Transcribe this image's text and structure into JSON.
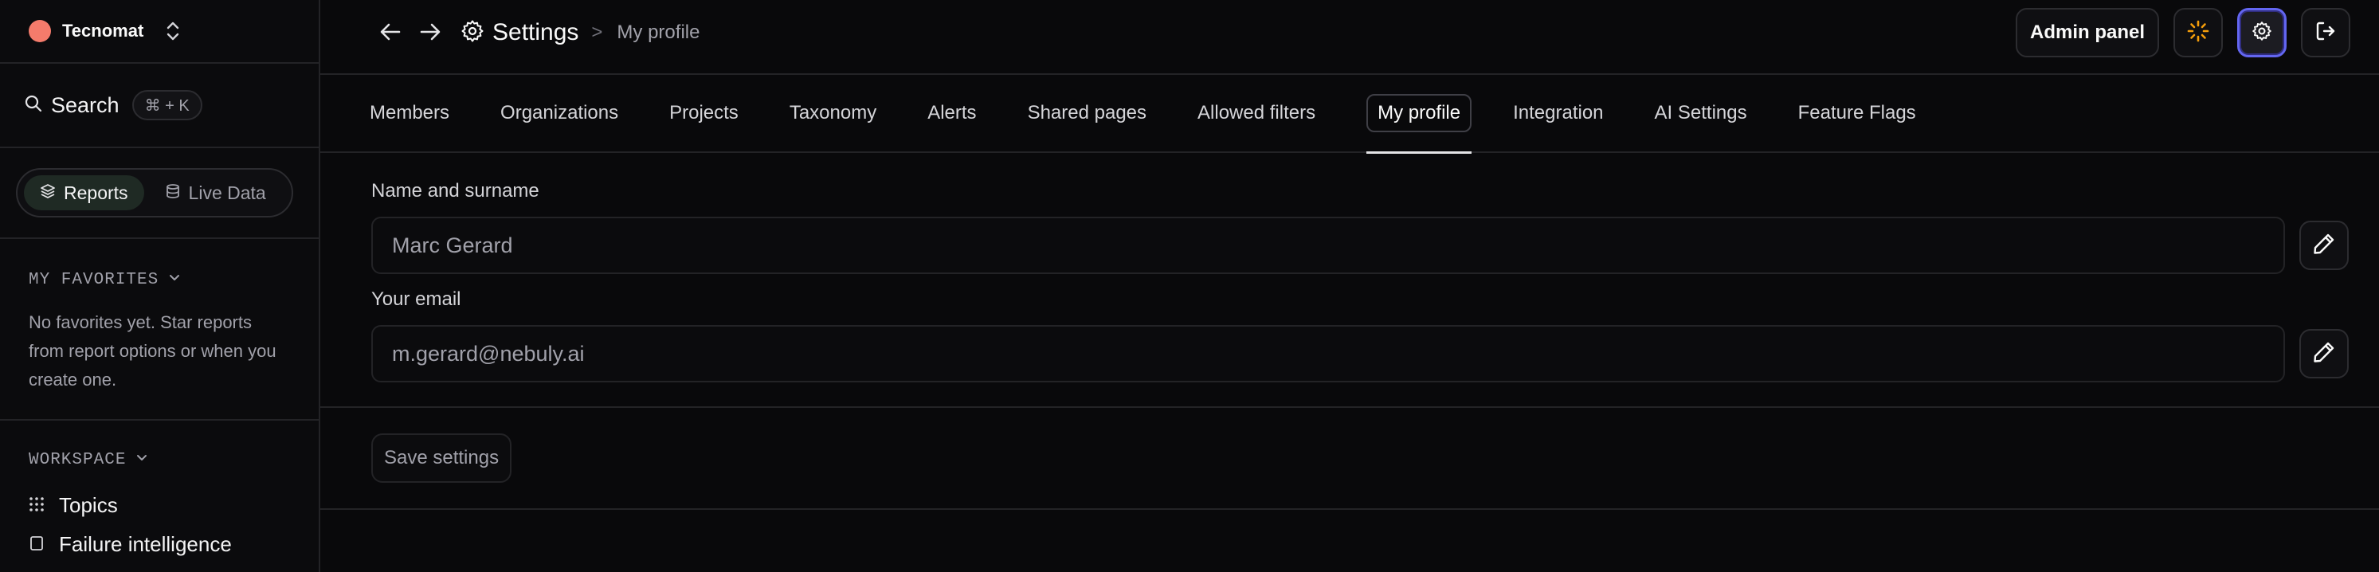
{
  "sidebar": {
    "org_name": "Tecnomat",
    "search_label": "Search",
    "search_shortcut": "⌘ + K",
    "toggle": {
      "reports": "Reports",
      "live_data": "Live Data"
    },
    "favorites": {
      "heading": "MY FAVORITES",
      "empty_text": "No favorites yet. Star reports from report options or when you create one."
    },
    "workspace": {
      "heading": "WORKSPACE",
      "items": [
        {
          "label": "Topics",
          "icon": "grid-dots-icon"
        },
        {
          "label": "Failure intelligence",
          "icon": "document-icon"
        }
      ]
    }
  },
  "topbar": {
    "breadcrumb_title": "Settings",
    "breadcrumb_separator": ">",
    "breadcrumb_current": "My profile",
    "admin_button": "Admin panel"
  },
  "tabs": [
    {
      "label": "Members"
    },
    {
      "label": "Organizations"
    },
    {
      "label": "Projects"
    },
    {
      "label": "Taxonomy"
    },
    {
      "label": "Alerts"
    },
    {
      "label": "Shared pages"
    },
    {
      "label": "Allowed filters"
    },
    {
      "label": "My profile",
      "active": true
    },
    {
      "label": "Integration"
    },
    {
      "label": "AI Settings"
    },
    {
      "label": "Feature Flags"
    }
  ],
  "form": {
    "name_label": "Name and surname",
    "name_value": "Marc Gerard",
    "email_label": "Your email",
    "email_value": "m.gerard@nebuly.ai",
    "save_label": "Save settings"
  },
  "colors": {
    "background": "#09090b",
    "border": "#232326",
    "org_dot": "#f47b6b",
    "accent_selected": "#6366f1",
    "loader": "#f59e0b"
  }
}
